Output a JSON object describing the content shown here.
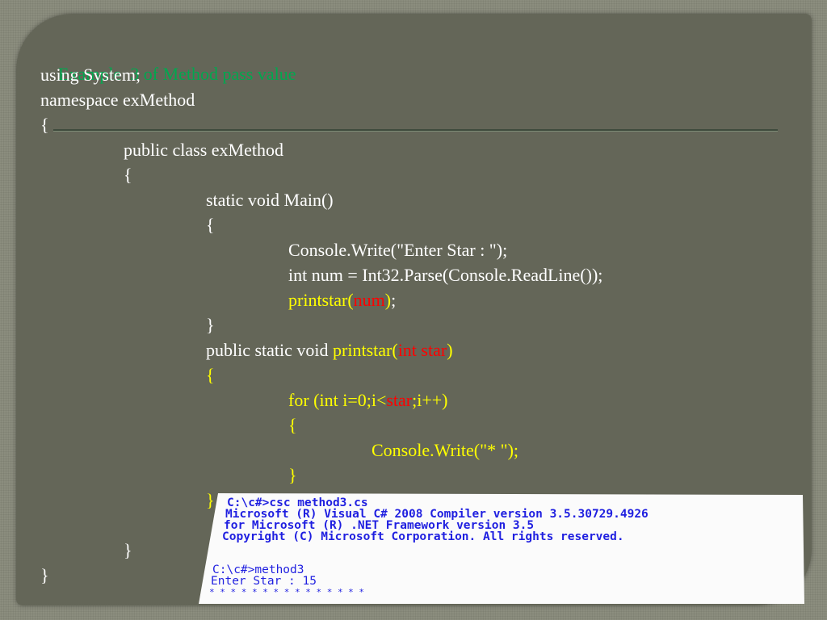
{
  "slide": {
    "title": "Example  3 of Method pass value",
    "colors": {
      "white": "#ffffff",
      "yellow": "#ffff00",
      "red": "#ff0000",
      "green": "#00a84f"
    },
    "lines": [
      {
        "indent": 0,
        "segs": [
          [
            "using System;",
            "white"
          ]
        ]
      },
      {
        "indent": 0,
        "segs": [
          [
            "namespace exMethod",
            "white"
          ]
        ]
      },
      {
        "indent": 0,
        "segs": [
          [
            "{",
            "white"
          ]
        ]
      },
      {
        "indent": 1,
        "segs": [
          [
            "public class exMethod",
            "white"
          ]
        ]
      },
      {
        "indent": 1,
        "segs": [
          [
            "{",
            "white"
          ]
        ]
      },
      {
        "indent": 2,
        "segs": [
          [
            "static void Main()",
            "white"
          ]
        ]
      },
      {
        "indent": 2,
        "segs": [
          [
            "{",
            "white"
          ]
        ]
      },
      {
        "indent": 3,
        "segs": [
          [
            "Console.Write(\"Enter Star : \");",
            "white"
          ]
        ]
      },
      {
        "indent": 3,
        "segs": [
          [
            "int num = Int32.Parse(Console.ReadLine());",
            "white"
          ]
        ]
      },
      {
        "indent": 3,
        "segs": [
          [
            "printstar(",
            "yellow"
          ],
          [
            "num",
            "red"
          ],
          [
            ")",
            "yellow"
          ],
          [
            ";",
            "white"
          ]
        ]
      },
      {
        "indent": 2,
        "segs": [
          [
            "}",
            "white"
          ]
        ]
      },
      {
        "indent": 2,
        "segs": [
          [
            "public static void ",
            "white"
          ],
          [
            "printstar(",
            "yellow"
          ],
          [
            "int star",
            "red"
          ],
          [
            ")",
            "yellow"
          ]
        ]
      },
      {
        "indent": 2,
        "segs": [
          [
            "{",
            "yellow"
          ]
        ]
      },
      {
        "indent": 3,
        "segs": [
          [
            "for (int i=0;i<",
            "yellow"
          ],
          [
            "star",
            "red"
          ],
          [
            ";i++)",
            "yellow"
          ]
        ]
      },
      {
        "indent": 3,
        "segs": [
          [
            "{",
            "yellow"
          ]
        ]
      },
      {
        "indent": 4,
        "segs": [
          [
            "Console.Write(\"* \");",
            "yellow"
          ]
        ]
      },
      {
        "indent": 3,
        "segs": [
          [
            "}",
            "yellow"
          ]
        ]
      },
      {
        "indent": 2,
        "segs": [
          [
            "}",
            "yellow"
          ]
        ]
      },
      {
        "indent": 1,
        "segs": [
          [
            "",
            "white"
          ]
        ]
      },
      {
        "indent": 1,
        "segs": [
          [
            "}",
            "white"
          ]
        ]
      },
      {
        "indent": 0,
        "segs": [
          [
            "}",
            "white"
          ]
        ]
      }
    ]
  },
  "console": {
    "lines": [
      "C:\\c#>csc method3.cs",
      "Microsoft (R) Visual C# 2008 Compiler version 3.5.30729.4926",
      "for Microsoft (R) .NET Framework version 3.5",
      "Copyright (C) Microsoft Corporation. All rights reserved.",
      "",
      "C:\\c#>method3",
      "Enter Star : 15",
      "* * * * * * * * * * * * * * *"
    ]
  }
}
